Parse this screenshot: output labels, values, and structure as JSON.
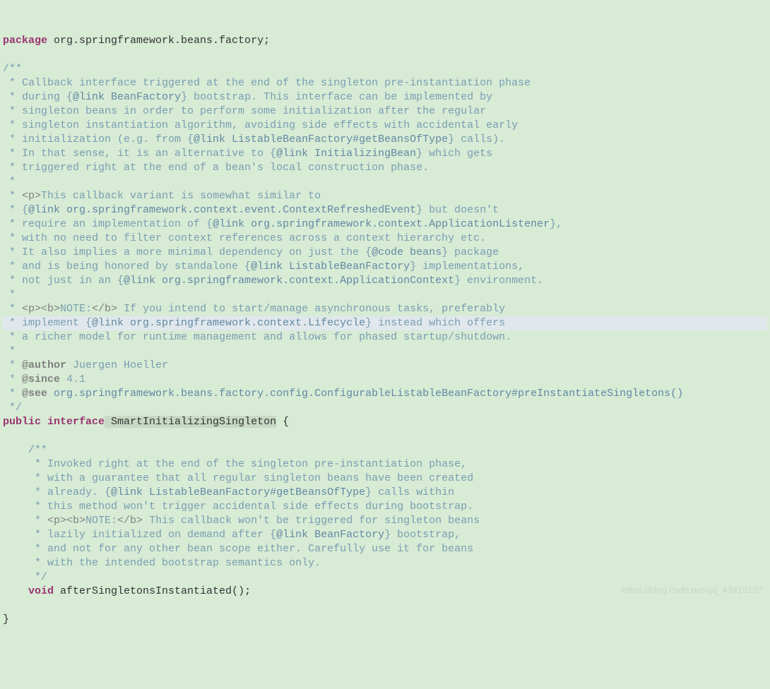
{
  "code": {
    "line1_kw": "package",
    "line1_pkg": " org.springframework.beans.factory",
    "line1_semi": ";",
    "c1": "/**",
    "c2": " * Callback interface triggered at the end of the singleton pre-instantiation phase",
    "c3a": " * during {",
    "c3b": "@link BeanFactory",
    "c3c": "} bootstrap. This interface can be implemented by",
    "c4": " * singleton beans in order to perform some initialization after the regular",
    "c5": " * singleton instantiation algorithm, avoiding side effects with accidental early",
    "c6a": " * initialization (e.g. from {",
    "c6b": "@link ListableBeanFactory#getBeansOfType",
    "c6c": "} calls).",
    "c7a": " * In that sense, it is an alternative to {",
    "c7b": "@link InitializingBean",
    "c7c": "} which gets",
    "c8": " * triggered right at the end of a bean's local construction phase.",
    "c9": " *",
    "c10a": " * ",
    "c10b": "<p>",
    "c10c": "This callback variant is somewhat similar to",
    "c11a": " * {",
    "c11b": "@link org.springframework.context.event.ContextRefreshedEvent",
    "c11c": "} but doesn't",
    "c12a": " * require an implementation of {",
    "c12b": "@link org.springframework.context.ApplicationListener",
    "c12c": "},",
    "c13": " * with no need to filter context references across a context hierarchy etc.",
    "c14a": " * It also implies a more minimal dependency on just the {",
    "c14b": "@code beans",
    "c14c": "} package",
    "c15a": " * and is being honored by standalone {",
    "c15b": "@link ListableBeanFactory",
    "c15c": "} implementations,",
    "c16a": " * not just in an {",
    "c16b": "@link org.springframework.context.ApplicationContext",
    "c16c": "} environment.",
    "c17": " *",
    "c18a": " * ",
    "c18b": "<p><b>",
    "c18c": "NOTE:",
    "c18d": "</b>",
    "c18e": " If you intend to start/manage asynchronous tasks, preferably",
    "c19a": " * implement {",
    "c19b": "@link org.springframework.context.Lifecycle",
    "c19c": "} instead which offers",
    "c20": " * a richer model for runtime management and allows for phased startup/shutdown.",
    "c21": " *",
    "c22a": " * ",
    "c22b": "@author",
    "c22c": " Juergen Hoeller",
    "c23a": " * ",
    "c23b": "@since",
    "c23c": " 4.1",
    "c24a": " * ",
    "c24b": "@see",
    "c24c": " org.springframework.beans.factory.config.ConfigurableListableBeanFactory#preInstantiateSingletons()",
    "c25": " */",
    "decl_kw1": "public",
    "decl_kw2": " interface",
    "decl_name": " SmartInitializingSingleton",
    "decl_brace": " {",
    "m1": "    /**",
    "m2": "     * Invoked right at the end of the singleton pre-instantiation phase,",
    "m3": "     * with a guarantee that all regular singleton beans have been created",
    "m4a": "     * already. {",
    "m4b": "@link ListableBeanFactory#getBeansOfType",
    "m4c": "} calls within",
    "m5": "     * this method won't trigger accidental side effects during bootstrap.",
    "m6a": "     * ",
    "m6b": "<p><b>",
    "m6c": "NOTE:",
    "m6d": "</b>",
    "m6e": " This callback won't be triggered for singleton beans",
    "m7a": "     * lazily initialized on demand after {",
    "m7b": "@link BeanFactory",
    "m7c": "} bootstrap,",
    "m8": "     * and not for any other bean scope either. Carefully use it for beans",
    "m9": "     * with the intended bootstrap semantics only.",
    "m10": "     */",
    "m11_kw": "    void",
    "m11_name": " afterSingletonsInstantiated",
    "m11_paren": "();",
    "close": "}",
    "watermark": "https://blog.csdn.net/qq_43416157"
  }
}
